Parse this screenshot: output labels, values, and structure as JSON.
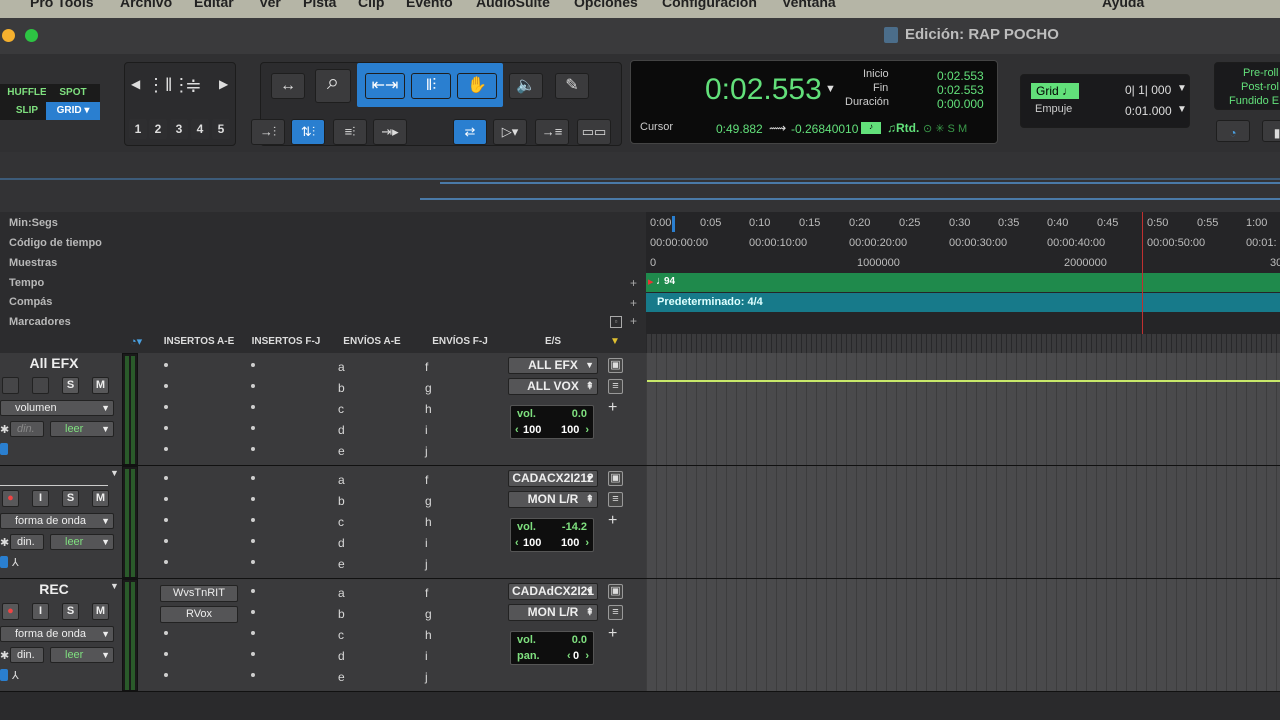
{
  "menu": [
    "Pro Tools",
    "Archivo",
    "Editar",
    "Ver",
    "Pista",
    "Clip",
    "Evento",
    "AudioSuite",
    "Opciones",
    "Configuración",
    "Ventana",
    "Ayuda"
  ],
  "window_title": "Edición: RAP POCHO",
  "edit_modes": {
    "shuffle": "HUFFLE",
    "spot": "SPOT",
    "slip": "SLIP",
    "grid": "GRID"
  },
  "zoom_presets": [
    "1",
    "2",
    "3",
    "4",
    "5"
  ],
  "counter": {
    "main": "0:02.553",
    "inicio_label": "Inicio",
    "inicio": "0:02.553",
    "fin_label": "Fin",
    "fin": "0:02.553",
    "duracion_label": "Duración",
    "duracion": "0:00.000",
    "cursor_label": "Cursor",
    "cursor": "0:49.882",
    "cursor_sample": "-0.26840010",
    "rtd_label": "Rtd."
  },
  "grid": {
    "label": "Grid",
    "value": "0| 1| 000",
    "nudge_label": "Empuje",
    "nudge_value": "0:01.000"
  },
  "preroll": {
    "pre": "Pre-roll",
    "post": "Post-rol",
    "fade": "Fundido E"
  },
  "rulers": {
    "labels": [
      "Min:Segs",
      "Código de tiempo",
      "Muestras",
      "Tempo",
      "Compás",
      "Marcadores"
    ],
    "minsecs": [
      "0:00",
      "0:05",
      "0:10",
      "0:15",
      "0:20",
      "0:25",
      "0:30",
      "0:35",
      "0:40",
      "0:45",
      "0:50",
      "0:55",
      "1:00"
    ],
    "timecode": [
      "00:00:00:00",
      "00:00:10:00",
      "00:00:20:00",
      "00:00:30:00",
      "00:00:40:00",
      "00:00:50:00",
      "00:01:"
    ],
    "samples": [
      "0",
      "1000000",
      "2000000",
      "30"
    ],
    "tempo": "94",
    "meter": "Predeterminado: 4/4"
  },
  "columns": [
    "INSERTOS A-E",
    "INSERTOS F-J",
    "ENVÍOS A-E",
    "ENVÍOS F-J",
    "E/S"
  ],
  "sends_ae": [
    "a",
    "b",
    "c",
    "d",
    "e"
  ],
  "sends_fj": [
    "f",
    "g",
    "h",
    "i",
    "j"
  ],
  "tracks": [
    {
      "name": "All EFX",
      "view": "volumen",
      "auto_left": "din.",
      "auto_right": "leer",
      "out1": "ALL EFX",
      "out2": "ALL VOX",
      "vol_label": "vol.",
      "vol": "0.0",
      "pan_l": "100",
      "pan_r": "100",
      "inserts": []
    },
    {
      "name": "",
      "view": "forma de onda",
      "auto_left": "din.",
      "auto_right": "leer",
      "out1": "CADACX2I212",
      "out2": "MON L/R",
      "vol_label": "vol.",
      "vol": "-14.2",
      "pan_l": "100",
      "pan_r": "100",
      "inserts": []
    },
    {
      "name": "REC",
      "view": "forma de onda",
      "auto_left": "din.",
      "auto_right": "leer",
      "out1": "CADAdCX2I21",
      "out2": "MON L/R",
      "vol_label": "vol.",
      "vol": "0.0",
      "pan_label": "pan.",
      "pan": "0",
      "inserts": [
        "WvsTnRIT",
        "RVox"
      ]
    }
  ],
  "track_buttons": {
    "s": "S",
    "m": "M",
    "i": "I"
  },
  "colors": {
    "accent": "#2a7fd0",
    "tempo_bar": "#1f8a4c",
    "meter_bar": "#177a8a",
    "green_text": "#62e07a"
  }
}
